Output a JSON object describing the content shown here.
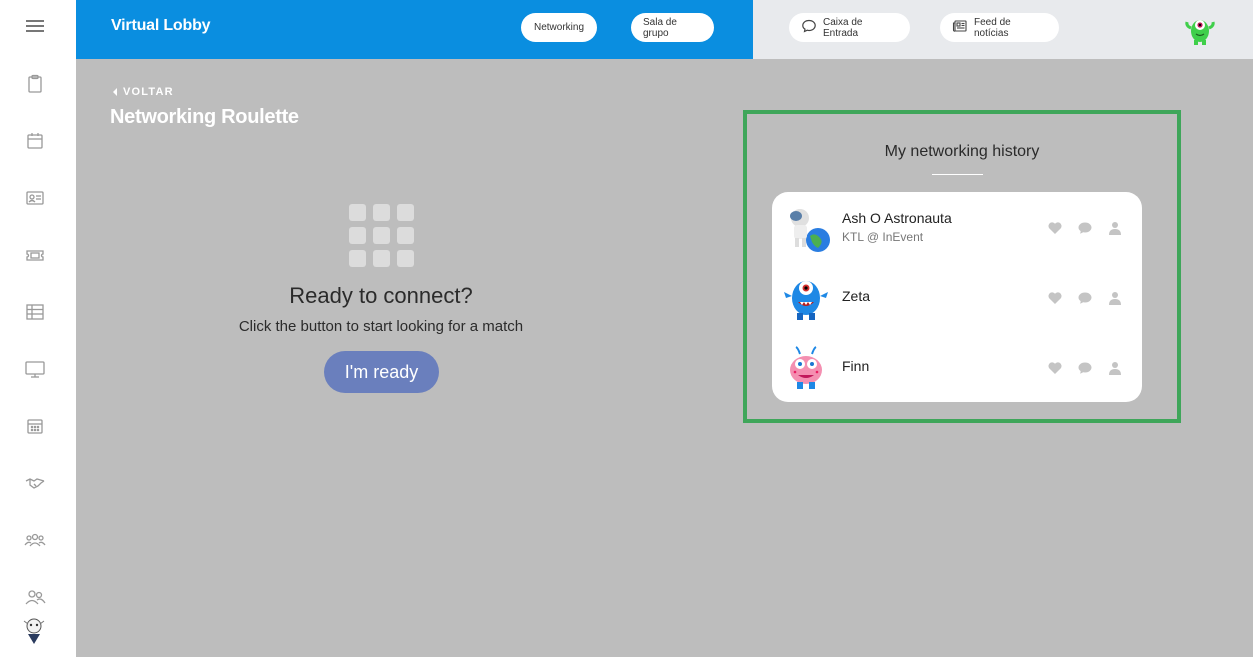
{
  "header": {
    "app_title": "Virtual Lobby",
    "nav": {
      "networking": "Networking",
      "sala_de_grupo": "Sala de grupo",
      "inbox": "Caixa de Entrada",
      "news_feed": "Feed de notícias"
    }
  },
  "sidebar": {
    "items": [
      {
        "icon": "clipboard-icon"
      },
      {
        "icon": "calendar-icon"
      },
      {
        "icon": "id-card-icon"
      },
      {
        "icon": "ticket-icon"
      },
      {
        "icon": "table-icon"
      },
      {
        "icon": "monitor-icon"
      },
      {
        "icon": "schedule-icon"
      },
      {
        "icon": "handshake-icon"
      },
      {
        "icon": "group-icon"
      },
      {
        "icon": "people-icon"
      }
    ]
  },
  "page": {
    "back_label": "VOLTAR",
    "title": "Networking Roulette"
  },
  "roulette": {
    "heading": "Ready to connect?",
    "subtext": "Click the button to start looking for a match",
    "button_label": "I'm ready"
  },
  "history": {
    "title": "My networking history",
    "people": [
      {
        "name": "Ash O Astronauta",
        "org": "KTL @ InEvent",
        "avatar": "astronaut-avatar"
      },
      {
        "name": "Zeta",
        "org": "",
        "avatar": "blue-monster-avatar"
      },
      {
        "name": "Finn",
        "org": "",
        "avatar": "pink-monster-avatar"
      }
    ]
  },
  "colors": {
    "topbar_blue": "#0a8ee0",
    "ready_button": "#6a7fbd",
    "highlight_border": "#3fa65a",
    "background": "#bdbdbd"
  }
}
